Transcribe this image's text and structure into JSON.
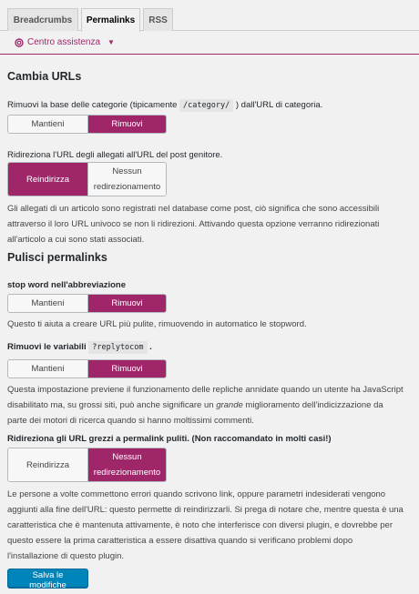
{
  "tabs": [
    {
      "label": "Breadcrumbs",
      "active": false
    },
    {
      "label": "Permalinks",
      "active": true
    },
    {
      "label": "RSS",
      "active": false
    }
  ],
  "help": {
    "label": "Centro assistenza"
  },
  "section1": {
    "title": "Cambia URLs",
    "strip_category": {
      "label_before": "Rimuovi la base delle categorie (tipicamente",
      "code": "/category/",
      "label_after": ") dall'URL di categoria.",
      "options": [
        "Mantieni",
        "Rimuovi"
      ],
      "selected": "Rimuovi"
    },
    "attachments": {
      "label": "Ridireziona l'URL degli allegati all'URL del post genitore.",
      "options": [
        "Reindirizza",
        "Nessun redirezionamento"
      ],
      "selected": "Reindirizza",
      "description": "Gli allegati di un articolo sono registrati nel database come post, ciò significa che sono accessibili attraverso il loro URL univoco se non li ridirezioni. Attivando questa opzione verranno ridirezionati all'articolo a cui sono stati associati."
    }
  },
  "section2": {
    "title": "Pulisci permalinks",
    "stopwords": {
      "label": "stop word nell'abbreviazione",
      "options": [
        "Mantieni",
        "Rimuovi"
      ],
      "selected": "Rimuovi",
      "description": "Questo ti aiuta a creare URL più pulite, rimuovendo in automatico le stopword."
    },
    "replytocom": {
      "label_before": "Rimuovi le variabili",
      "code": "?replytocom",
      "label_after": ".",
      "options": [
        "Mantieni",
        "Rimuovi"
      ],
      "selected": "Rimuovi",
      "desc_before": "Questa impostazione previene il funzionamento delle repliche annidate quando un utente ha JavaScript disabilitato ma, su grossi siti, può anche significare un",
      "desc_em": "grande",
      "desc_after": "miglioramento dell'indicizzazione da parte dei motori di ricerca quando si hanno moltissimi commenti."
    },
    "ugly_urls": {
      "label": "Ridireziona gli URL grezzi a permalink puliti. (Non raccomandato in molti casi!)",
      "options": [
        "Reindirizza",
        "Nessun redirezionamento"
      ],
      "selected": "Nessun redirezionamento",
      "description": "Le persone a volte commettono errori quando scrivono link, oppure parametri indesiderati vengono aggiunti alla fine dell'URL: questo permette di reindirizzarli. Si prega di notare che, mentre questa è una caratteristica che è mantenuta attivamente, è noto che interferisce con diversi plugin, e dovrebbe per questo essere la prima caratteristica a essere disattiva quando si verificano problemi dopo l'installazione di questo plugin."
    }
  },
  "save_label": "Salva le modifiche",
  "colors": {
    "accent": "#a0266a",
    "primary_button": "#0085ba"
  }
}
